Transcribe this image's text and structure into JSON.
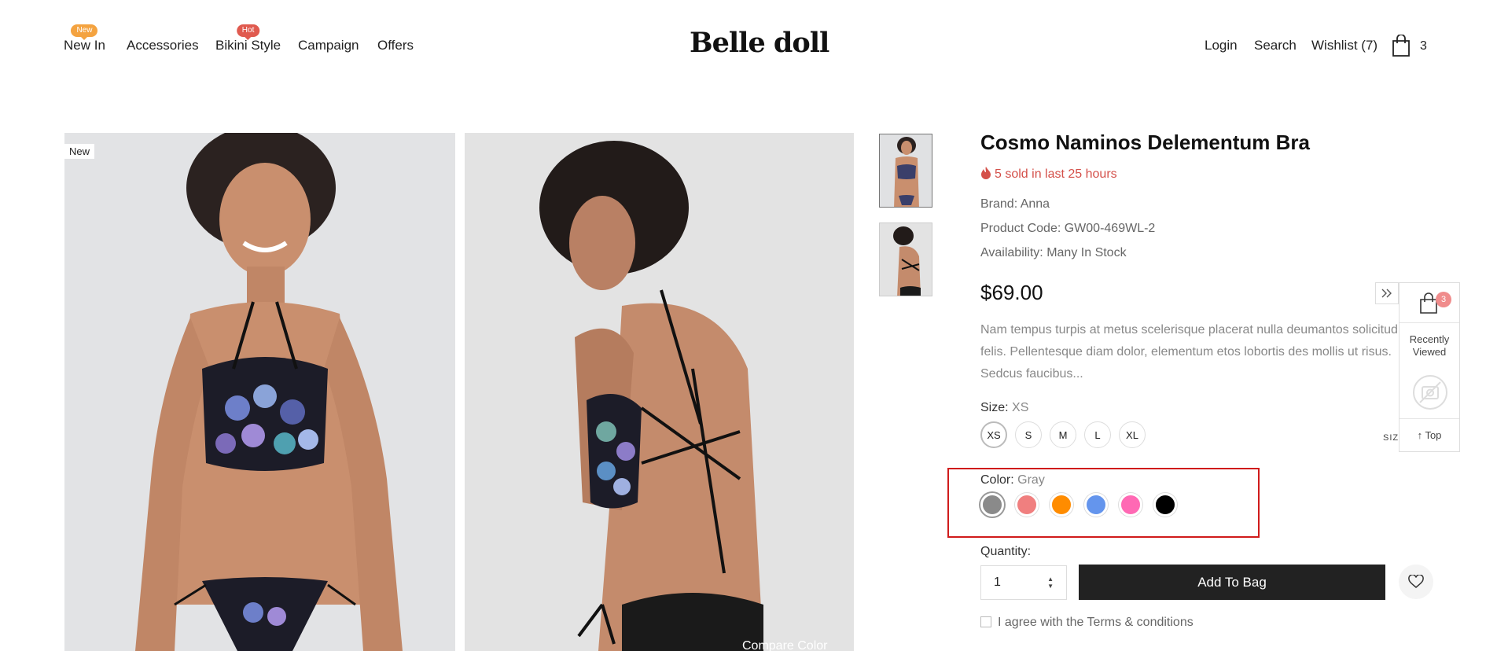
{
  "nav": {
    "items": [
      {
        "label": "New In",
        "badge": "New"
      },
      {
        "label": "Accessories"
      },
      {
        "label": "Bikini Style",
        "badge": "Hot"
      },
      {
        "label": "Campaign"
      },
      {
        "label": "Offers"
      }
    ]
  },
  "logo": "Belle doll",
  "header_right": {
    "login": "Login",
    "search": "Search",
    "wishlist": "Wishlist (7)",
    "cart_count": "3"
  },
  "gallery": {
    "new_tag": "New",
    "compare_color": "Compare Color"
  },
  "product": {
    "title": "Cosmo Naminos Delementum Bra",
    "sold_text": "5 sold in last 25 hours",
    "brand_label": "Brand:",
    "brand": "Anna",
    "code_label": "Product Code:",
    "code": "GW00-469WL-2",
    "availability_label": "Availability:",
    "availability": "Many In Stock",
    "price": "$69.00",
    "description": "Nam tempus turpis at metus scelerisque placerat nulla deumantos solicitud felis. Pellentesque diam dolor, elementum etos lobortis des mollis ut risus. Sedcus faucibus...",
    "size_label": "Size:",
    "size_selected": "XS",
    "sizes": [
      "XS",
      "S",
      "M",
      "L",
      "XL"
    ],
    "color_label": "Color:",
    "color_selected": "Gray",
    "colors": [
      "#8a8a8a",
      "#f07f7f",
      "#ff8c00",
      "#6495ed",
      "#ff69b4",
      "#000000"
    ],
    "quantity_label": "Quantity:",
    "quantity": "1",
    "add_to_bag": "Add To Bag",
    "agree": "I agree with the Terms & conditions"
  },
  "side_panel": {
    "cart_count": "3",
    "recently_line1": "Recently",
    "recently_line2": "Viewed",
    "top": "Top",
    "size_guide_partial": "SIZE"
  },
  "accent_colors": {
    "badge_new": "#f4a340",
    "badge_hot": "#e05a4f",
    "sold_text": "#d4504a",
    "highlight_box": "#d01b1b",
    "button_dark": "#222222"
  }
}
